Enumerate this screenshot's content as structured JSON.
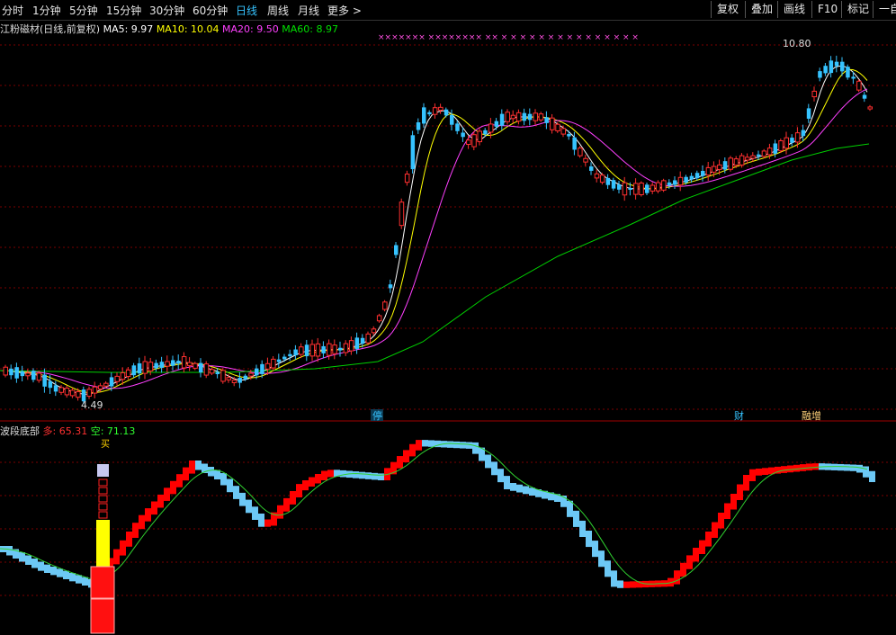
{
  "toolbar": {
    "periods": [
      "分时",
      "1分钟",
      "5分钟",
      "15分钟",
      "30分钟",
      "60分钟",
      "日线",
      "周线",
      "月线",
      "更多 >"
    ],
    "active": "日线",
    "buttons": [
      "复权",
      "叠加",
      "画线",
      "F10",
      "标记",
      "一自选"
    ]
  },
  "price_panel": {
    "title": "江粉磁材(日线,前复权)",
    "ma": [
      {
        "label": "MA5: 9.97",
        "color": "#ffffff"
      },
      {
        "label": "MA10: 10.04",
        "color": "#ffff00"
      },
      {
        "label": "MA20: 9.50",
        "color": "#ff40ff"
      },
      {
        "label": "MA60: 8.97",
        "color": "#00e000"
      }
    ],
    "high_label": "10.80",
    "low_label": "4.49",
    "markers": [
      {
        "text": "停",
        "color": "#36c3ff"
      },
      {
        "text": "财",
        "color": "#36c3ff"
      },
      {
        "text": "融增",
        "color": "#ffd27a"
      }
    ],
    "top_marks": "××××××× ×××××××× ×× × × × × × × × × × × × × × × ×"
  },
  "indicator_panel": {
    "title": "波段底部",
    "long": {
      "label": "多: 65.31",
      "color": "#ff3030"
    },
    "short": {
      "label": "空: 71.13",
      "color": "#30ff30"
    },
    "buy_label": "买"
  },
  "colors": {
    "up": "#ff3030",
    "down": "#36c3ff",
    "grid": "#7a0000",
    "ind_up": "#ff0000",
    "ind_down": "#6cc8f5"
  }
}
